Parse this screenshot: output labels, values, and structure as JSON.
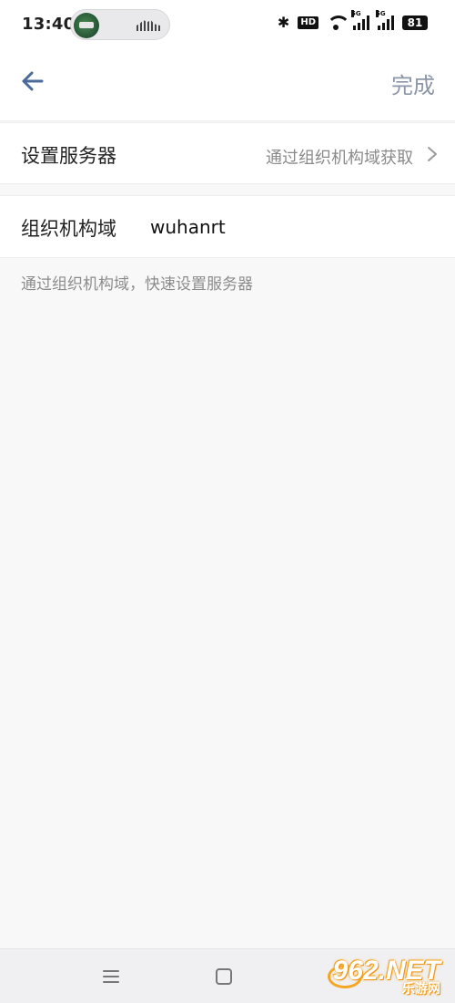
{
  "status_bar": {
    "time": "13:40",
    "hd_label": "HD",
    "network_1": "5G",
    "network_2": "5G",
    "battery": "81"
  },
  "header": {
    "done_label": "完成"
  },
  "server_row": {
    "label": "设置服务器",
    "value": "通过组织机构域获取"
  },
  "domain_row": {
    "label": "组织机构域",
    "value": "wuhanrt"
  },
  "hint": "通过组织机构域，快速设置服务器",
  "watermark": {
    "main": "962.NET",
    "sub": "乐游网"
  },
  "colors": {
    "accent": "#4a6a9c",
    "done": "#8b96a8"
  }
}
